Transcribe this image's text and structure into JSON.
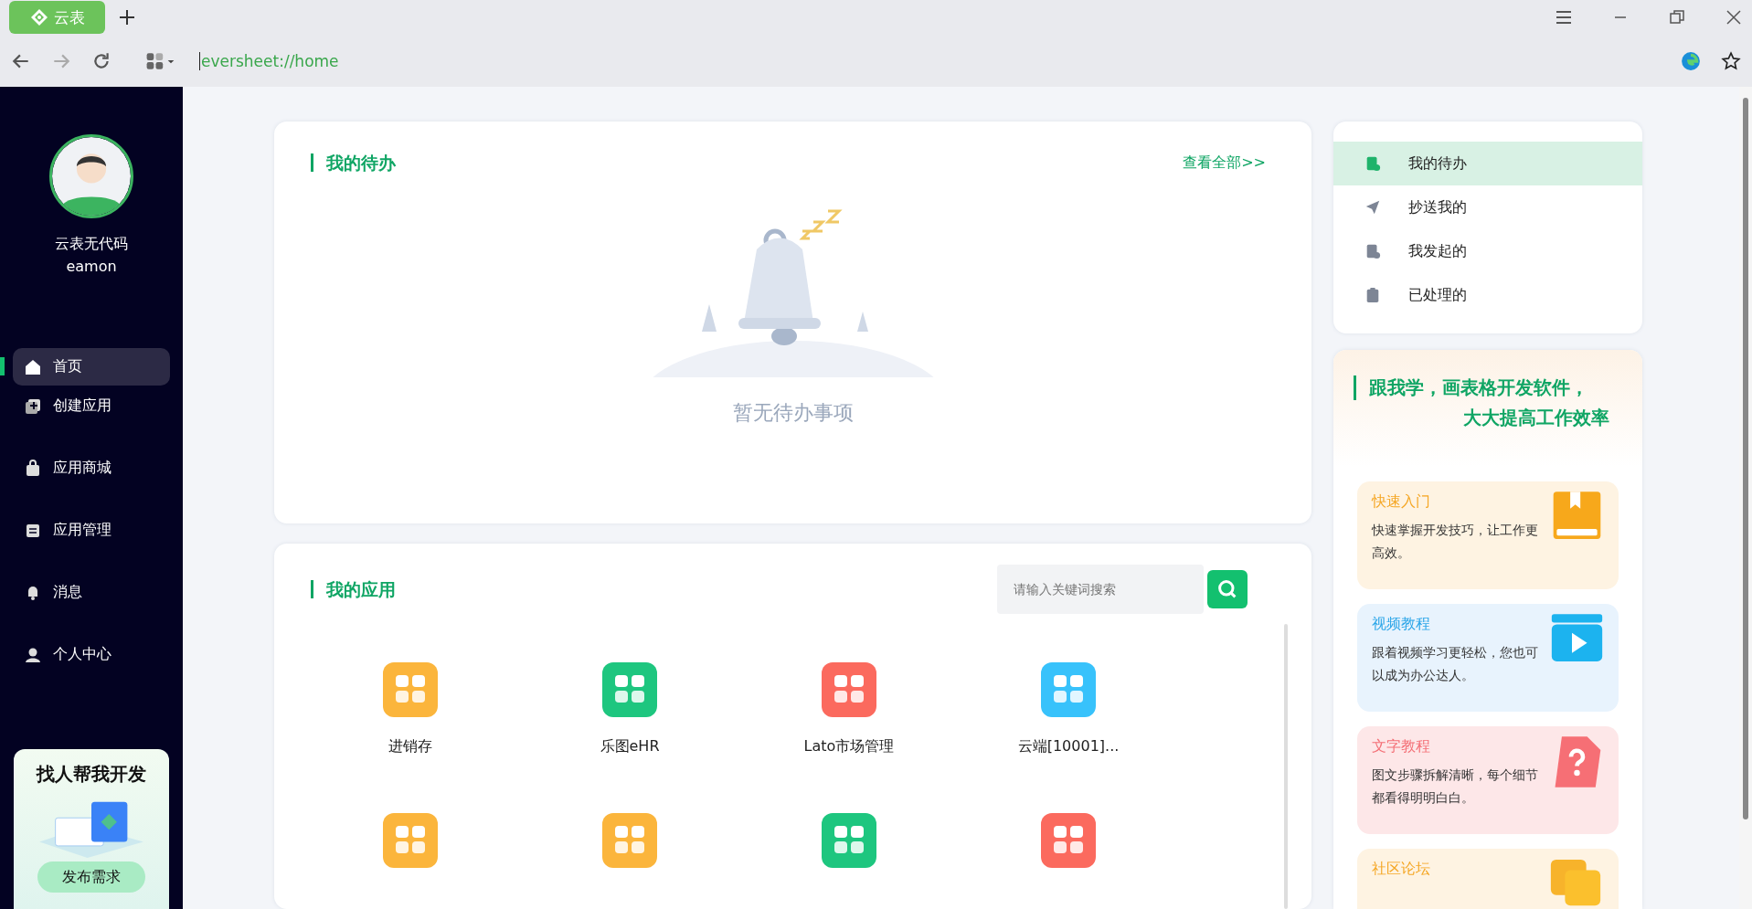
{
  "browser": {
    "tab_label": "云表",
    "address": "eversheet://home"
  },
  "user": {
    "name": "云表无代码",
    "account": "eamon"
  },
  "nav": [
    {
      "label": "首页",
      "selected": true
    },
    {
      "label": "创建应用",
      "selected": false
    },
    {
      "label": "应用商城",
      "selected": false
    },
    {
      "label": "应用管理",
      "selected": false
    },
    {
      "label": "消息",
      "selected": false
    },
    {
      "label": "个人中心",
      "selected": false
    }
  ],
  "promo_banner": {
    "title": "找人帮我开发",
    "button": "发布需求"
  },
  "todo": {
    "title": "我的待办",
    "view_all": "查看全部>>",
    "empty_text": "暂无待办事项"
  },
  "apps": {
    "title": "我的应用",
    "search_placeholder": "请输入关键词搜索",
    "items": [
      {
        "label": "进销存",
        "color": "#fbb53c"
      },
      {
        "label": "乐图eHR",
        "color": "#1ec67f"
      },
      {
        "label": "Lato市场管理",
        "color": "#fb6a5e"
      },
      {
        "label": "云端[10001]...",
        "color": "#38c2fb"
      },
      {
        "color": "#fbb53c"
      },
      {
        "color": "#fbb53c"
      },
      {
        "color": "#1ec67f"
      },
      {
        "color": "#fb6a5e"
      }
    ]
  },
  "task_menu": [
    {
      "label": "我的待办",
      "selected": true
    },
    {
      "label": "抄送我的",
      "selected": false
    },
    {
      "label": "我发起的",
      "selected": false
    },
    {
      "label": "已处理的",
      "selected": false
    }
  ],
  "learn": {
    "title_line1": "跟我学，画表格开发软件，",
    "title_line2": "大大提高工作效率",
    "cards": [
      {
        "kind": "book",
        "title": "快速入门",
        "text": "快速掌握开发技巧，让工作更高效。"
      },
      {
        "kind": "video",
        "title": "视频教程",
        "text": "跟着视频学习更轻松，您也可以成为办公达人。"
      },
      {
        "kind": "doc",
        "title": "文字教程",
        "text": "图文步骤拆解清晰，每个细节都看得明明白白。"
      },
      {
        "kind": "forum",
        "title": "社区论坛"
      }
    ]
  }
}
